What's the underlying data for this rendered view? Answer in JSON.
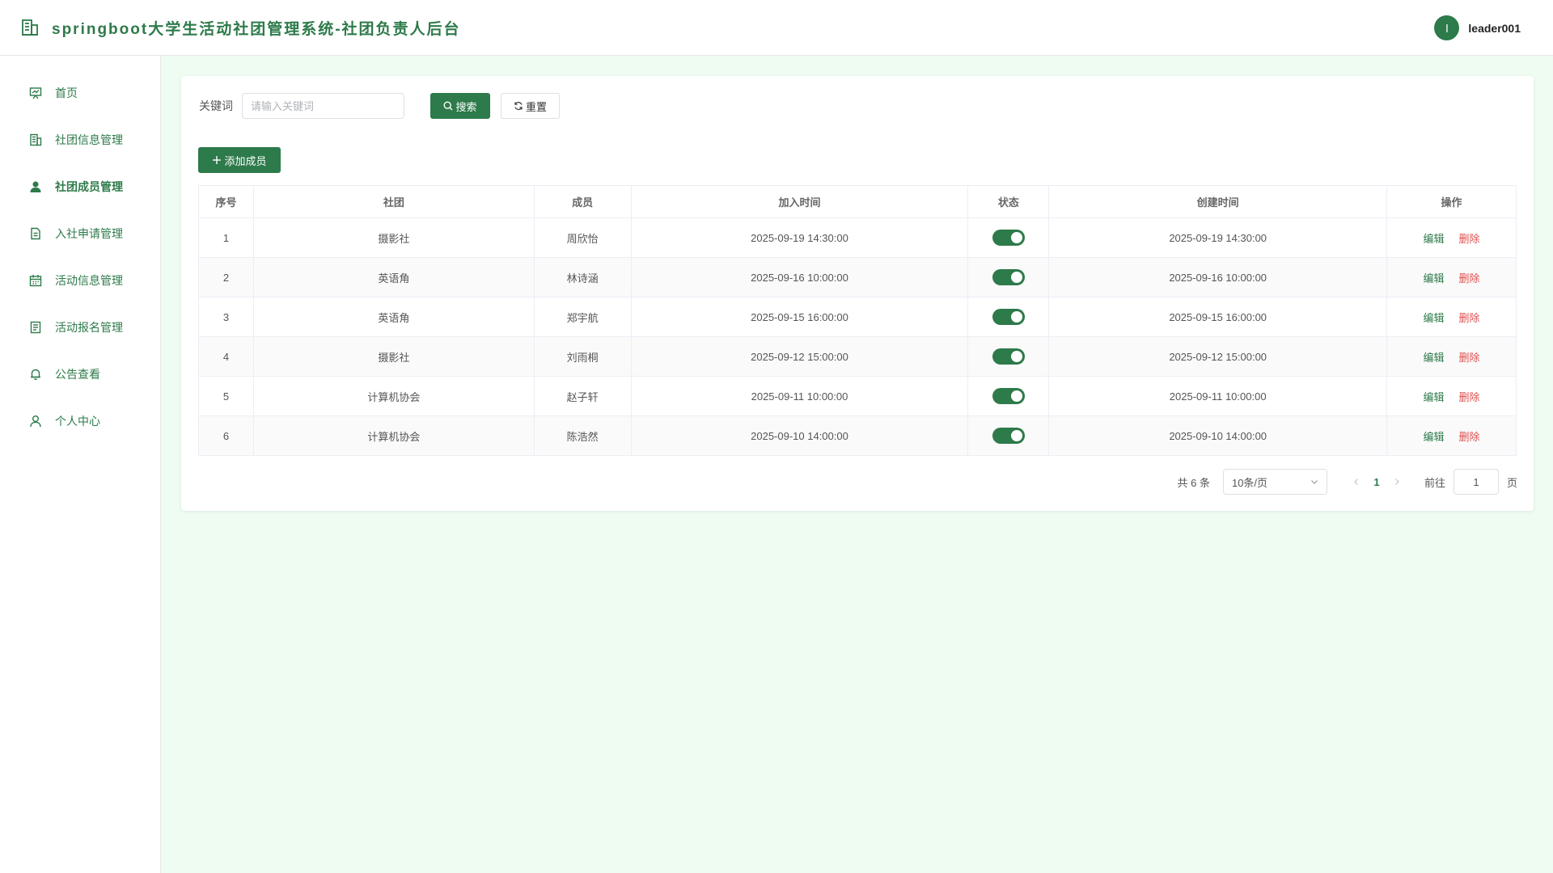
{
  "app": {
    "title": "springboot大学生活动社团管理系统-社团负责人后台",
    "user": {
      "avatar_letter": "l",
      "name": "leader001"
    }
  },
  "sidebar": {
    "items": [
      {
        "label": "首页",
        "icon": "presentation-chart-icon",
        "active": false
      },
      {
        "label": "社团信息管理",
        "icon": "building-icon",
        "active": false
      },
      {
        "label": "社团成员管理",
        "icon": "user-filled-icon",
        "active": true
      },
      {
        "label": "入社申请管理",
        "icon": "document-icon",
        "active": false
      },
      {
        "label": "活动信息管理",
        "icon": "calendar-icon",
        "active": false
      },
      {
        "label": "活动报名管理",
        "icon": "form-icon",
        "active": false
      },
      {
        "label": "公告查看",
        "icon": "bell-icon",
        "active": false
      },
      {
        "label": "个人中心",
        "icon": "user-icon",
        "active": false
      }
    ]
  },
  "search": {
    "label": "关键词",
    "placeholder": "请输入关键词",
    "value": "",
    "search_button": "搜索",
    "reset_button": "重置"
  },
  "toolbar": {
    "add_button": "添加成员"
  },
  "table": {
    "headers": [
      "序号",
      "社团",
      "成员",
      "加入时间",
      "状态",
      "创建时间",
      "操作"
    ],
    "rows": [
      {
        "index": "1",
        "club": "摄影社",
        "member": "周欣怡",
        "join_time": "2025-09-19 14:30:00",
        "status": true,
        "created": "2025-09-19 14:30:00"
      },
      {
        "index": "2",
        "club": "英语角",
        "member": "林诗涵",
        "join_time": "2025-09-16 10:00:00",
        "status": true,
        "created": "2025-09-16 10:00:00"
      },
      {
        "index": "3",
        "club": "英语角",
        "member": "郑宇航",
        "join_time": "2025-09-15 16:00:00",
        "status": true,
        "created": "2025-09-15 16:00:00"
      },
      {
        "index": "4",
        "club": "摄影社",
        "member": "刘雨桐",
        "join_time": "2025-09-12 15:00:00",
        "status": true,
        "created": "2025-09-12 15:00:00"
      },
      {
        "index": "5",
        "club": "计算机协会",
        "member": "赵子轩",
        "join_time": "2025-09-11 10:00:00",
        "status": true,
        "created": "2025-09-11 10:00:00"
      },
      {
        "index": "6",
        "club": "计算机协会",
        "member": "陈浩然",
        "join_time": "2025-09-10 14:00:00",
        "status": true,
        "created": "2025-09-10 14:00:00"
      }
    ],
    "edit_label": "编辑",
    "delete_label": "删除"
  },
  "pagination": {
    "total_text": "共 6 条",
    "page_size": "10条/页",
    "current_page": "1",
    "goto_label": "前往",
    "goto_value": "1",
    "page_unit": "页"
  },
  "colors": {
    "accent": "#2d7a4a",
    "danger": "#e04f4f",
    "background": "#eefcf1"
  }
}
